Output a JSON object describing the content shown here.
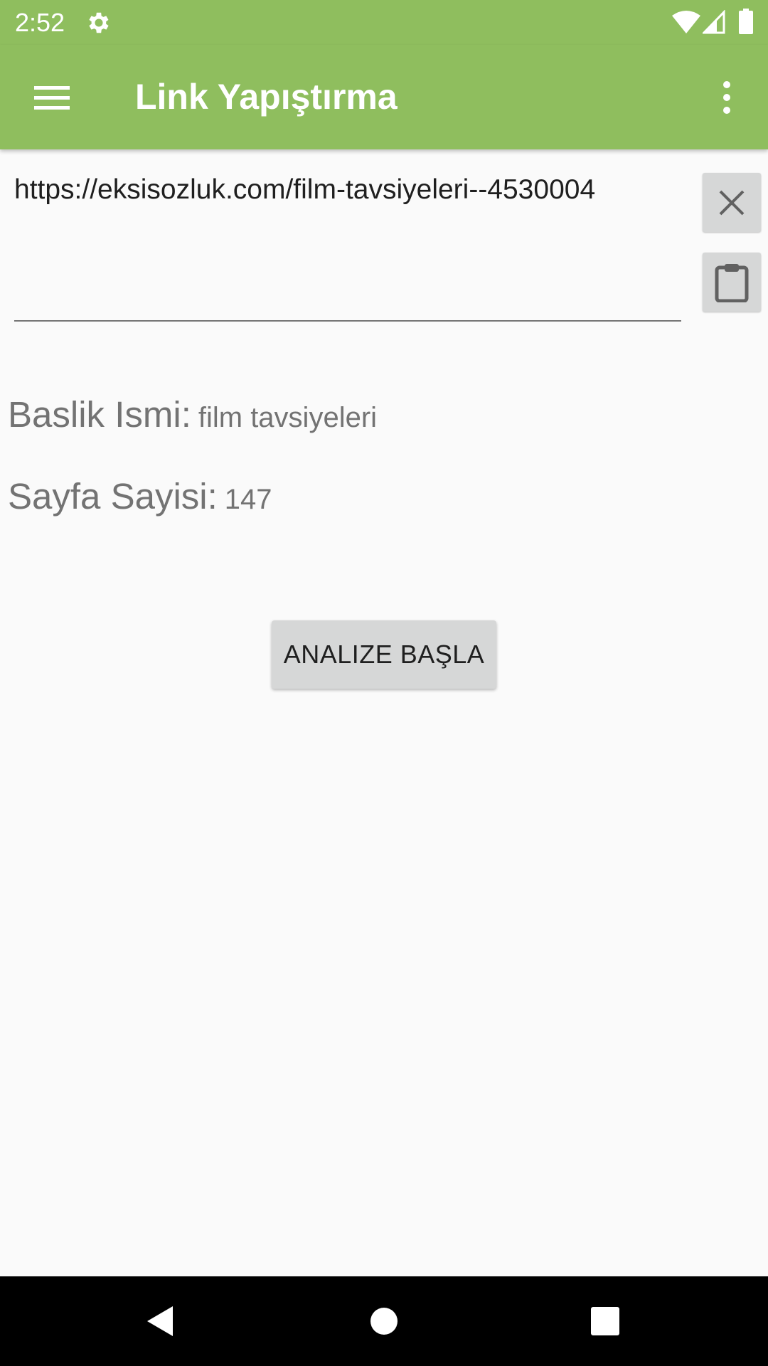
{
  "status_bar": {
    "time": "2:52",
    "icons": [
      "gear-icon",
      "wifi-icon",
      "signal-icon",
      "battery-icon"
    ]
  },
  "app_bar": {
    "title": "Link Yapıştırma",
    "background_color": "#8fbe5e",
    "menu_icon": "hamburger-menu-icon",
    "overflow_icon": "more-vert-icon"
  },
  "url_input": {
    "value": "https://eksisozluk.com/film-tavsiyeleri--4530004",
    "clear_icon": "close-icon",
    "paste_icon": "clipboard-icon"
  },
  "info": {
    "title_label": "Baslik Ismi:",
    "title_value": "film tavsiyeleri",
    "pages_label": "Sayfa Sayisi:",
    "pages_value": "147"
  },
  "actions": {
    "analyze_label": "ANALIZE BAŞLA"
  },
  "nav_bar": {
    "icons": [
      "back-icon",
      "home-icon",
      "recents-icon"
    ]
  }
}
